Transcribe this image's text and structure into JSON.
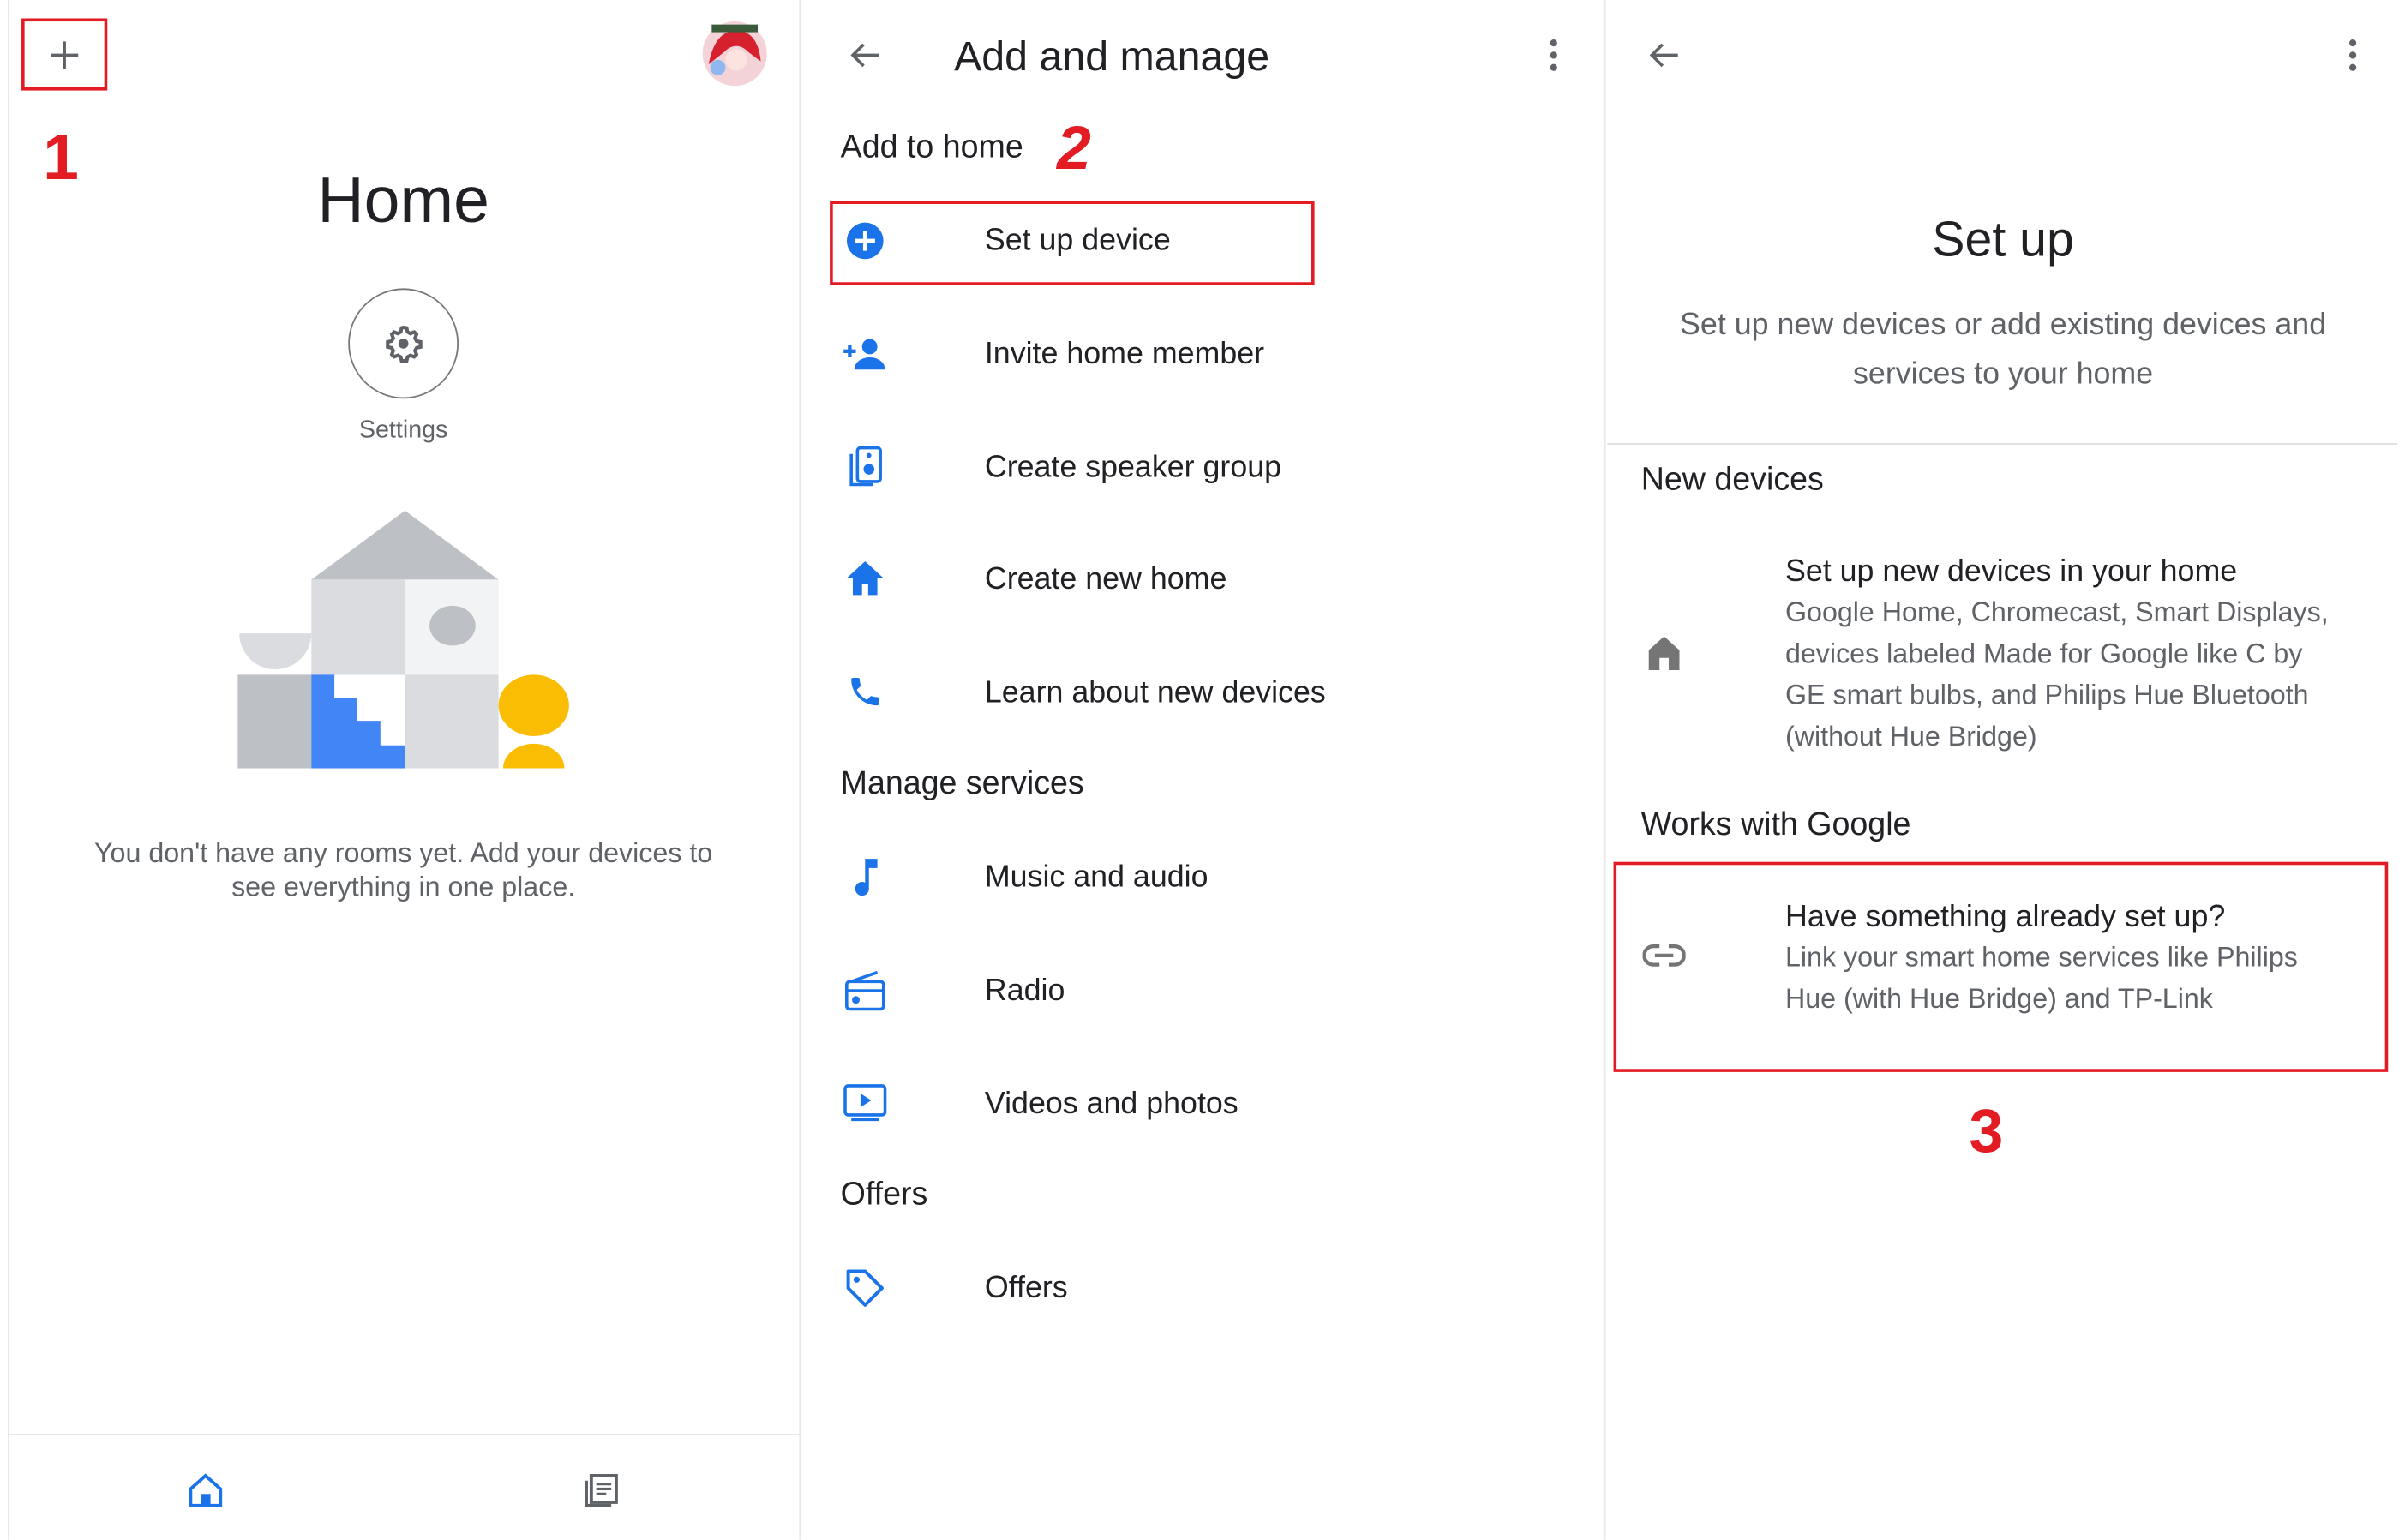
{
  "annotations": {
    "step1": "1",
    "step2": "2",
    "step3": "3",
    "highlight_color": "#e31b23"
  },
  "home_screen": {
    "title": "Home",
    "settings_label": "Settings",
    "empty_message_line1": "You don't have any rooms yet. Add your devices to",
    "empty_message_line2": "see everything in one place.",
    "icons": {
      "add": "plus-icon",
      "avatar": "avatar",
      "settings": "gear-icon",
      "nav_home": "home-icon",
      "nav_feed": "feed-icon"
    },
    "accent": "#4285f4"
  },
  "add_manage": {
    "title": "Add and manage",
    "sections": [
      {
        "header": "Add to home",
        "items": [
          {
            "label": "Set up device",
            "icon": "add-circle-icon"
          },
          {
            "label": "Invite home member",
            "icon": "person-add-icon"
          },
          {
            "label": "Create speaker group",
            "icon": "speaker-icon"
          },
          {
            "label": "Create new home",
            "icon": "home-icon"
          },
          {
            "label": "Learn about new devices",
            "icon": "phone-icon"
          }
        ]
      },
      {
        "header": "Manage services",
        "items": [
          {
            "label": "Music and audio",
            "icon": "music-note-icon"
          },
          {
            "label": "Radio",
            "icon": "radio-icon"
          },
          {
            "label": "Videos and photos",
            "icon": "video-icon"
          }
        ]
      },
      {
        "header": "Offers",
        "items": [
          {
            "label": "Offers",
            "icon": "tag-icon"
          }
        ]
      }
    ]
  },
  "setup": {
    "title": "Set up",
    "description_line1": "Set up new devices or add existing devices and",
    "description_line2": "services to your home",
    "new_devices": {
      "header": "New devices",
      "title": "Set up new devices in your home",
      "lines": [
        "Google Home, Chromecast, Smart Displays,",
        "devices labeled Made for Google like C by",
        "GE smart bulbs, and Philips Hue Bluetooth",
        "(without Hue Bridge)"
      ]
    },
    "works_with_google": {
      "header": "Works with Google",
      "title": "Have something already set up?",
      "lines": [
        "Link your smart home services like Philips",
        "Hue (with Hue Bridge) and TP-Link"
      ]
    }
  }
}
